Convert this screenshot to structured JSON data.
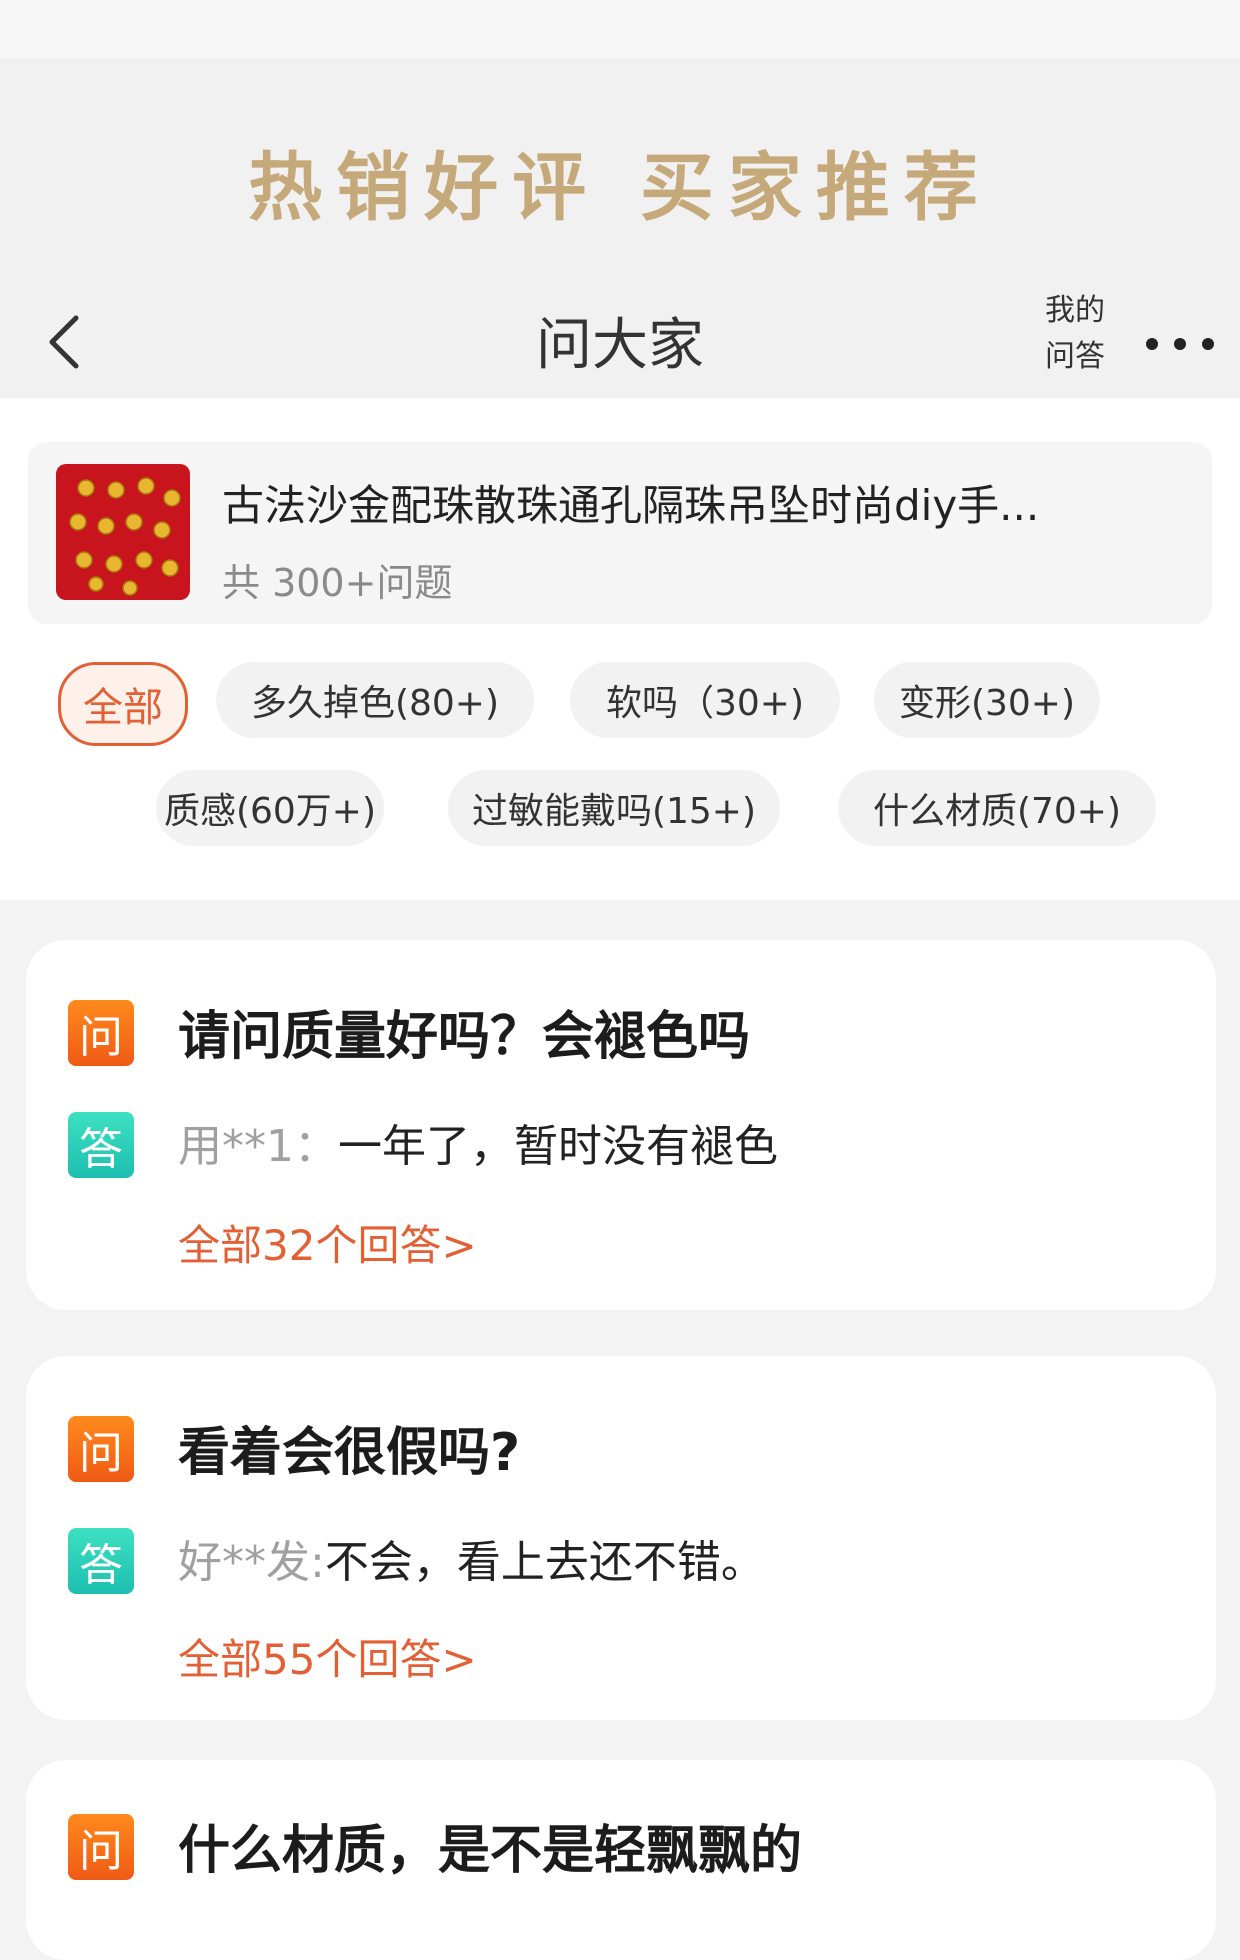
{
  "banner": {
    "text": "热销好评  买家推荐"
  },
  "navbar": {
    "title": "问大家",
    "my_qa_line1": "我的",
    "my_qa_line2": "问答"
  },
  "product": {
    "title": "古法沙金配珠散珠通孔隔珠吊坠时尚diy手...",
    "count": "共 300+问题"
  },
  "chips": [
    {
      "label": "全部",
      "active": true
    },
    {
      "label": "多久掉色(80+)"
    },
    {
      "label": "软吗（30+)"
    },
    {
      "label": "变形(30+)"
    },
    {
      "label": "质感(60万+)"
    },
    {
      "label": "过敏能戴吗(15+)"
    },
    {
      "label": "什么材质(70+)"
    }
  ],
  "qa": [
    {
      "q_badge": "问",
      "question": "请问质量好吗？会褪色吗",
      "a_badge": "答",
      "answer_user": "用**1：",
      "answer_text": "一年了，暂时没有褪色",
      "all_link": "全部32个回答>"
    },
    {
      "q_badge": "问",
      "question": "看着会很假吗?",
      "a_badge": "答",
      "answer_user": "好**发:",
      "answer_text": "不会，看上去还不错。",
      "all_link": "全部55个回答>"
    },
    {
      "q_badge": "问",
      "question": "什么材质，是不是轻飘飘的"
    }
  ],
  "colors": {
    "accent": "#e35f34",
    "banner_gold": "#c5a97a",
    "question_badge": "#f26b1d",
    "answer_badge": "#2ccdb9",
    "product_thumb": "#c8141c"
  },
  "icons": [
    "back-arrow-icon",
    "more-dots-icon",
    "gold-beads-thumbnail"
  ]
}
